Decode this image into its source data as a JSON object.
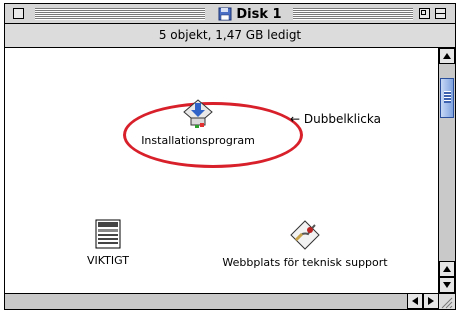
{
  "window": {
    "title": "Disk 1",
    "title_icon": "floppy-disk-icon"
  },
  "infobar": {
    "status": "5 objekt, 1,47 GB ledigt"
  },
  "items": {
    "installer": {
      "label": "Installationsprogram",
      "icon": "installer-icon"
    },
    "viktigt": {
      "label": "VIKTIGT",
      "icon": "document-icon"
    },
    "web": {
      "label": "Webbplats för teknisk support",
      "icon": "web-link-icon"
    }
  },
  "annotation": {
    "note": "← Dubbelklicka",
    "highlight_color": "#d8202b"
  },
  "scrollbar_colors": {
    "thumb": "#9bb8e8"
  }
}
